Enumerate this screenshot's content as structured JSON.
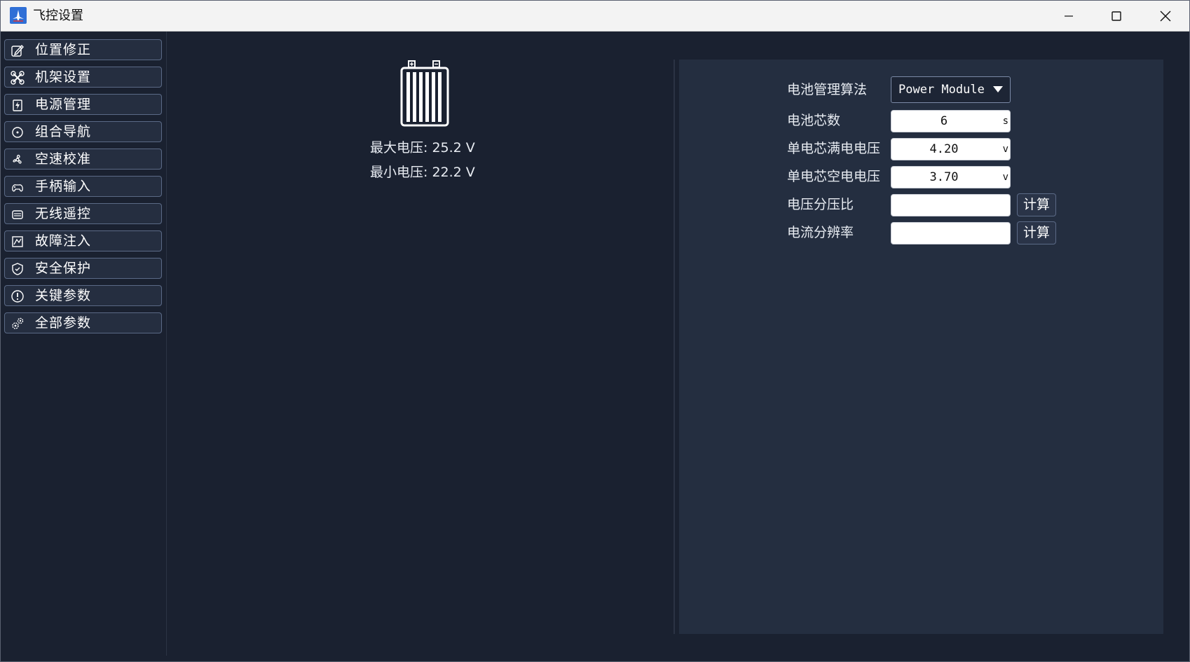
{
  "window": {
    "title": "飞控设置",
    "controls": {
      "minimize": "minimize-icon",
      "maximize": "maximize-icon",
      "close": "close-icon"
    }
  },
  "sidebar": {
    "items": [
      {
        "label": "位置修正",
        "icon": "edit-icon"
      },
      {
        "label": "机架设置",
        "icon": "drone-icon"
      },
      {
        "label": "电源管理",
        "icon": "power-icon"
      },
      {
        "label": "组合导航",
        "icon": "compass-icon"
      },
      {
        "label": "空速校准",
        "icon": "fan-icon"
      },
      {
        "label": "手柄输入",
        "icon": "gamepad-icon"
      },
      {
        "label": "无线遥控",
        "icon": "remote-icon"
      },
      {
        "label": "故障注入",
        "icon": "fault-icon"
      },
      {
        "label": "安全保护",
        "icon": "shield-icon"
      },
      {
        "label": "关键参数",
        "icon": "exclamation-icon"
      },
      {
        "label": "全部参数",
        "icon": "gears-icon"
      }
    ]
  },
  "battery": {
    "icon": "battery-icon",
    "max_voltage": "最大电压: 25.2 V",
    "min_voltage": "最小电压: 22.2 V"
  },
  "settings": {
    "algorithm": {
      "label": "电池管理算法",
      "value": "Power Module"
    },
    "cell_count": {
      "label": "电池芯数",
      "value": "6",
      "unit": "s"
    },
    "cell_full": {
      "label": "单电芯满电电压",
      "value": "4.20",
      "unit": "v"
    },
    "cell_empty": {
      "label": "单电芯空电电压",
      "value": "3.70",
      "unit": "v"
    },
    "voltage_divider": {
      "label": "电压分压比",
      "value": "",
      "button": "计算"
    },
    "current_resolution": {
      "label": "电流分辨率",
      "value": "",
      "button": "计算"
    }
  },
  "colors": {
    "background": "#1a2130",
    "panel": "#242e40",
    "nav_border": "#5b6a86",
    "text": "#ffffff"
  }
}
